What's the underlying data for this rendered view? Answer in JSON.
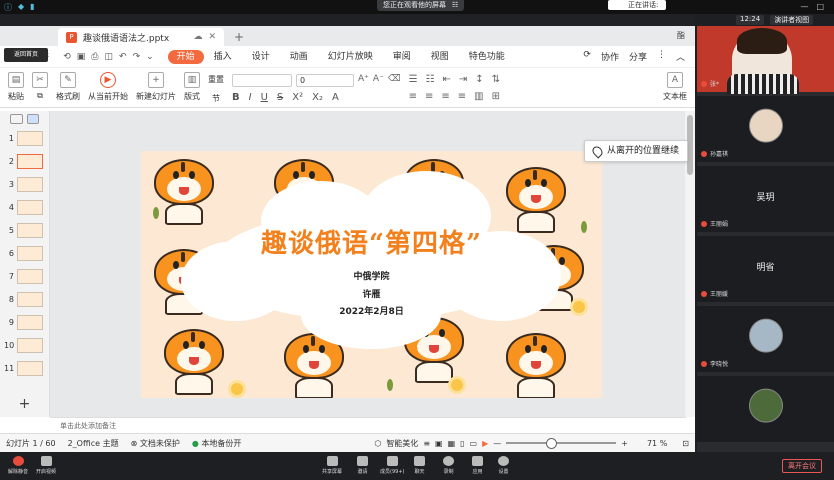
{
  "meeting": {
    "share_banner": "您正在观看他的屏幕",
    "share_icon": "☷",
    "speaking_label": "正在讲话:",
    "time": "12:24",
    "layout_label": "演讲者视图",
    "leave_label": "离开会议",
    "controls": [
      {
        "label": "解除静音",
        "icon": "mic-icon"
      },
      {
        "label": "开启视频",
        "icon": "camera-icon"
      },
      {
        "label": "共享屏幕",
        "icon": "share-screen-icon"
      },
      {
        "label": "邀请",
        "icon": "invite-icon"
      },
      {
        "label": "成员(99+)",
        "icon": "members-icon"
      },
      {
        "label": "聊天",
        "icon": "chat-icon"
      },
      {
        "label": "录制",
        "icon": "record-icon"
      },
      {
        "label": "应用",
        "icon": "apps-icon"
      },
      {
        "label": "设置",
        "icon": "settings-icon"
      }
    ]
  },
  "participants": [
    {
      "kind": "video",
      "name": "张*"
    },
    {
      "kind": "avatar",
      "name": "孙嘉祺"
    },
    {
      "kind": "text",
      "display": "吴玥",
      "name": "王丽娟"
    },
    {
      "kind": "text",
      "display": "明省",
      "name": "王丽媛"
    },
    {
      "kind": "avatar",
      "name": "李晓悦"
    },
    {
      "kind": "avatar",
      "name": ""
    }
  ],
  "wps": {
    "home_label": "返回首页",
    "file_name": "趣谈俄语语法之.pptx",
    "file_icon": "P",
    "user_label": "酯",
    "menu_file": "文件",
    "menus": [
      "开始",
      "插入",
      "设计",
      "动画",
      "幻灯片放映",
      "审阅",
      "视图",
      "特色功能"
    ],
    "active_menu": "开始",
    "right_actions": [
      "协作",
      "分享"
    ],
    "ribbon": {
      "paste": "粘贴",
      "format_painter": "格式刷",
      "play_from_current": "从当前开始",
      "new_slide": "新建幻灯片",
      "layout": "版式",
      "section": "节",
      "reset": "重置",
      "font_size_value": "0",
      "text_box": "文本框"
    },
    "resume_label": "从离开的位置继续",
    "notes_placeholder": "单击此处添加备注",
    "thumb_numbers": [
      "1",
      "2",
      "3",
      "4",
      "5",
      "6",
      "7",
      "8",
      "9",
      "10",
      "11"
    ],
    "current_slide_index": 1,
    "status": {
      "slide_counter": "幻灯片 1 / 60",
      "theme": "2_Office 主题",
      "protect": "文档未保护",
      "backup": "本地备份开",
      "beautify": "智能美化",
      "zoom": "71 %"
    }
  },
  "slide": {
    "title": "趣谈俄语“第四格”",
    "school": "中俄学院",
    "author": "许雁",
    "date": "2022年2月8日"
  },
  "colors": {
    "accent": "#f26a3d",
    "title_orange": "#f2811d",
    "slide_bg": "#fde9d3"
  }
}
